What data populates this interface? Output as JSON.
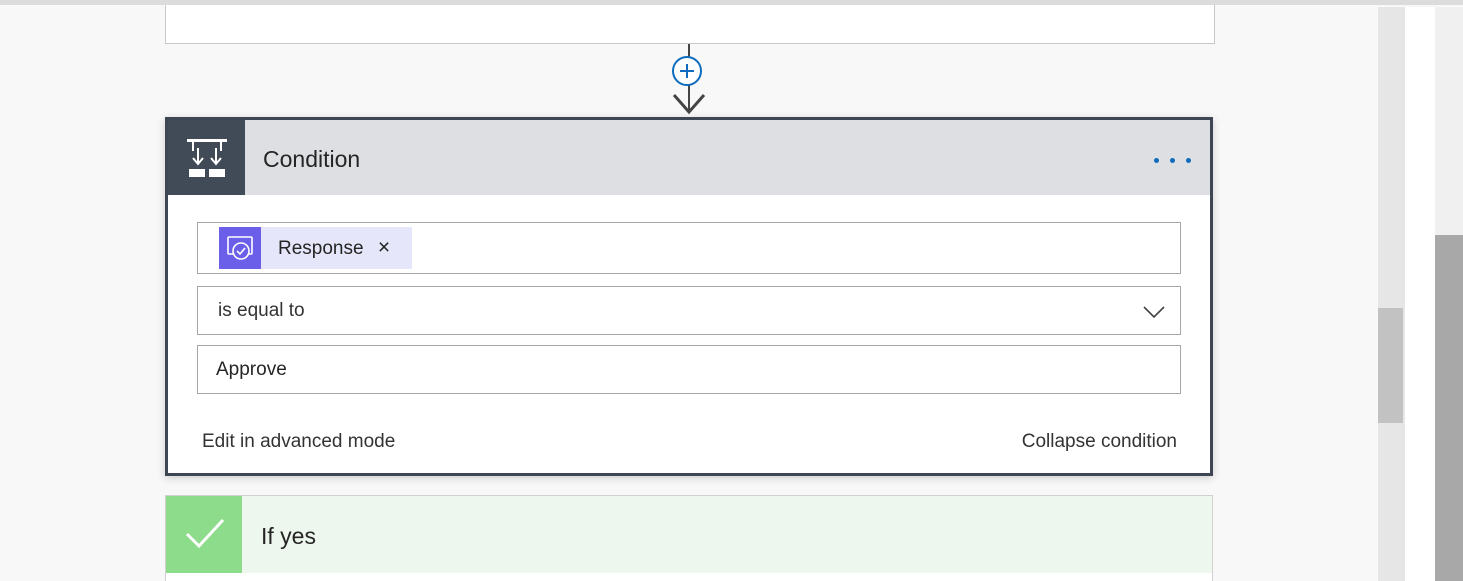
{
  "condition": {
    "title": "Condition",
    "more_label": "...",
    "token": {
      "label": "Response",
      "remove_label": "×",
      "icon": "approval-icon"
    },
    "operator": {
      "selected": "is equal to",
      "icon": "chevron-down-icon"
    },
    "value": "Approve",
    "advanced_link": "Edit in advanced mode",
    "collapse_link": "Collapse condition",
    "icon": "condition-icon"
  },
  "branch_yes": {
    "title": "If yes",
    "icon": "checkmark-icon"
  },
  "add_step_icon": "plus-icon",
  "colors": {
    "header_dark": "#414a57",
    "header_bg": "#dddfe2",
    "accent_blue": "#0f6cbd",
    "token_icon": "#6b5ee8",
    "token_bg": "#e6e6fa",
    "yes_green": "#8ddc8b",
    "yes_bg": "#eef7ee"
  }
}
